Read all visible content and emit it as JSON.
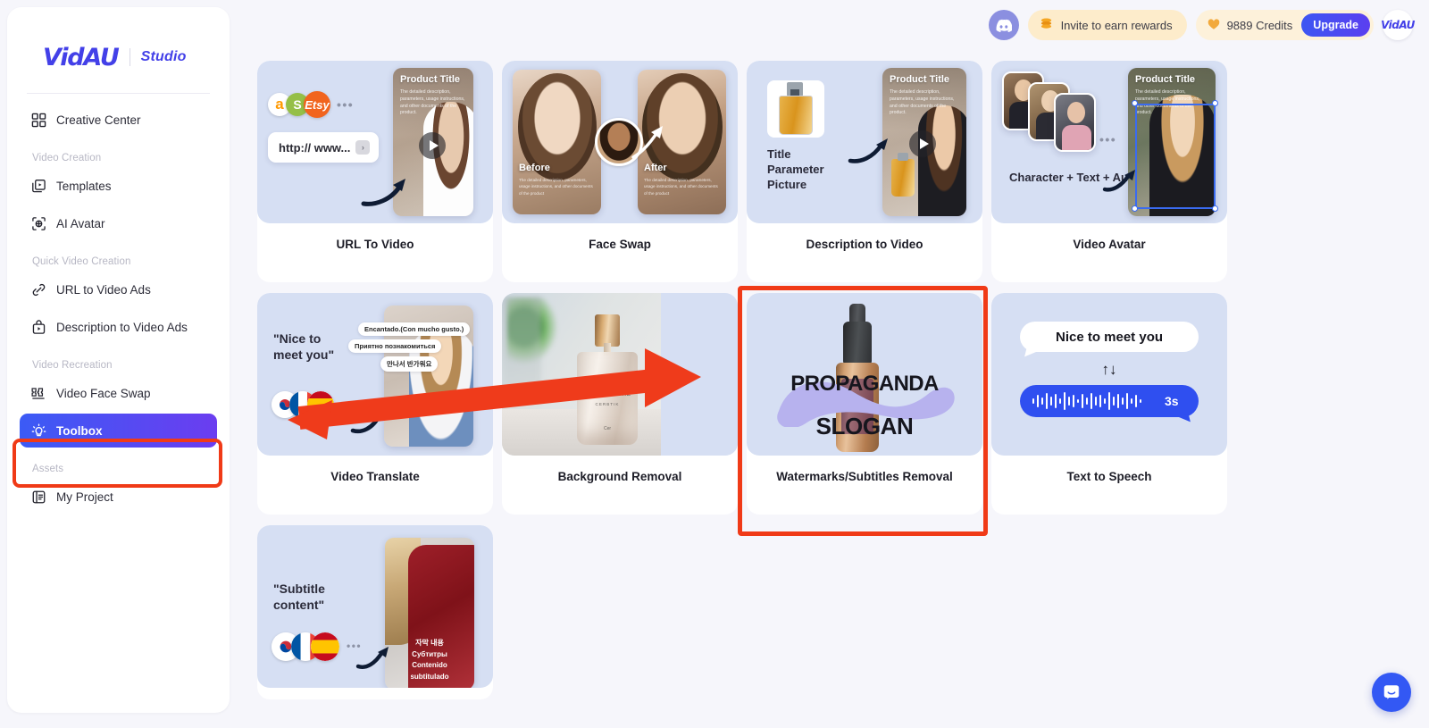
{
  "brand": {
    "logo": "VidAU",
    "studio": "Studio"
  },
  "sidebar": {
    "top_items": [
      {
        "label": "Creative Center",
        "icon": "grid-icon"
      }
    ],
    "groups": [
      {
        "label": "Video Creation",
        "items": [
          {
            "label": "Templates",
            "icon": "templates-icon"
          },
          {
            "label": "AI Avatar",
            "icon": "ai-avatar-icon"
          }
        ]
      },
      {
        "label": "Quick Video Creation",
        "items": [
          {
            "label": "URL to Video Ads",
            "icon": "link-icon"
          },
          {
            "label": "Description to Video Ads",
            "icon": "description-video-icon"
          }
        ]
      },
      {
        "label": "Video Recreation",
        "items": [
          {
            "label": "Video Face Swap",
            "icon": "face-swap-icon"
          },
          {
            "label": "Toolbox",
            "icon": "lightbulb-icon",
            "active": true
          }
        ]
      },
      {
        "label": "Assets",
        "items": [
          {
            "label": "My Project",
            "icon": "project-icon"
          }
        ]
      }
    ]
  },
  "header": {
    "discord_icon": "discord-icon",
    "invite_label": "Invite to earn rewards",
    "invite_icon": "coins-icon",
    "credits_label": "9889 Credits",
    "credits_icon": "diamond-icon",
    "upgrade_label": "Upgrade",
    "avatar_label": "VidAU"
  },
  "cards": [
    {
      "label": "URL To Video",
      "art": "url-to-video",
      "art_text": {
        "chips": [
          "a",
          "S",
          "Etsy"
        ],
        "dots": "•••",
        "url": "http:// www...",
        "go": "›",
        "phone_title": "Product Title",
        "phone_sub": "The detailed description, parameters, usage instructions, and other documents of the product."
      }
    },
    {
      "label": "Face Swap",
      "art": "face-swap",
      "art_text": {
        "before": "Before",
        "after": "After",
        "sub": "The detailed description, parameters, usage instructions, and other documents of the product"
      }
    },
    {
      "label": "Description to Video",
      "art": "description-to-video",
      "art_text": {
        "lines": "Title\nParameter\nPicture",
        "phone_title": "Product Title",
        "phone_sub": "The detailed description, parameters, usage instructions, and other documents of the product."
      }
    },
    {
      "label": "Video Avatar",
      "art": "video-avatar",
      "art_text": {
        "lines": "Character +\nText + Audio",
        "dots": "•••",
        "phone_title": "Product Title",
        "phone_sub": "The detailed description, parameters, usage instructions, and other documents of the product."
      }
    },
    {
      "label": "Video Translate",
      "art": "video-translate",
      "art_text": {
        "quote": "\"Nice to\nmeet you\"",
        "bubbles": [
          "Encantado.(Con mucho gusto.)",
          "Приятно познакомиться",
          "만나서 반가워요"
        ],
        "flags": [
          "KR",
          "FR",
          "ES"
        ]
      }
    },
    {
      "label": "Background Removal",
      "art": "background-removal",
      "art_text": {
        "bottle_brand": "CCCUSIATORE",
        "bottle_sub": "CERBTIK",
        "bottle_small": "Cer"
      }
    },
    {
      "label": "Watermarks/Subtitles Removal",
      "art": "watermark-removal",
      "art_text": {
        "line1": "PROPAGANDA",
        "line2": "SLOGAN"
      },
      "highlighted": true
    },
    {
      "label": "Text to Speech",
      "art": "text-to-speech",
      "art_text": {
        "phrase": "Nice to meet you",
        "swap_icon": "↑↓",
        "duration": "3s"
      }
    },
    {
      "label": "",
      "art": "subtitle-translate",
      "art_text": {
        "quote": "\"Subtitle\ncontent\"",
        "flags": [
          "KR",
          "FR",
          "ES"
        ],
        "dots": "•••",
        "overlay": "자막 내용\nСубтитры\nContenido\nsubtitulado"
      }
    }
  ],
  "annotations": {
    "highlight_color": "#f03a17",
    "arrow_color": "#ef3b1b",
    "toolbox_highlight": "Toolbox",
    "card_highlight": "Watermarks/Subtitles Removal"
  },
  "chat": {
    "icon": "chat-bubble-icon",
    "color": "#3358f4"
  },
  "theme": {
    "accent": "#4340e8",
    "page_bg": "#f6f6fb",
    "thumb_bg": "#d6dff3"
  }
}
